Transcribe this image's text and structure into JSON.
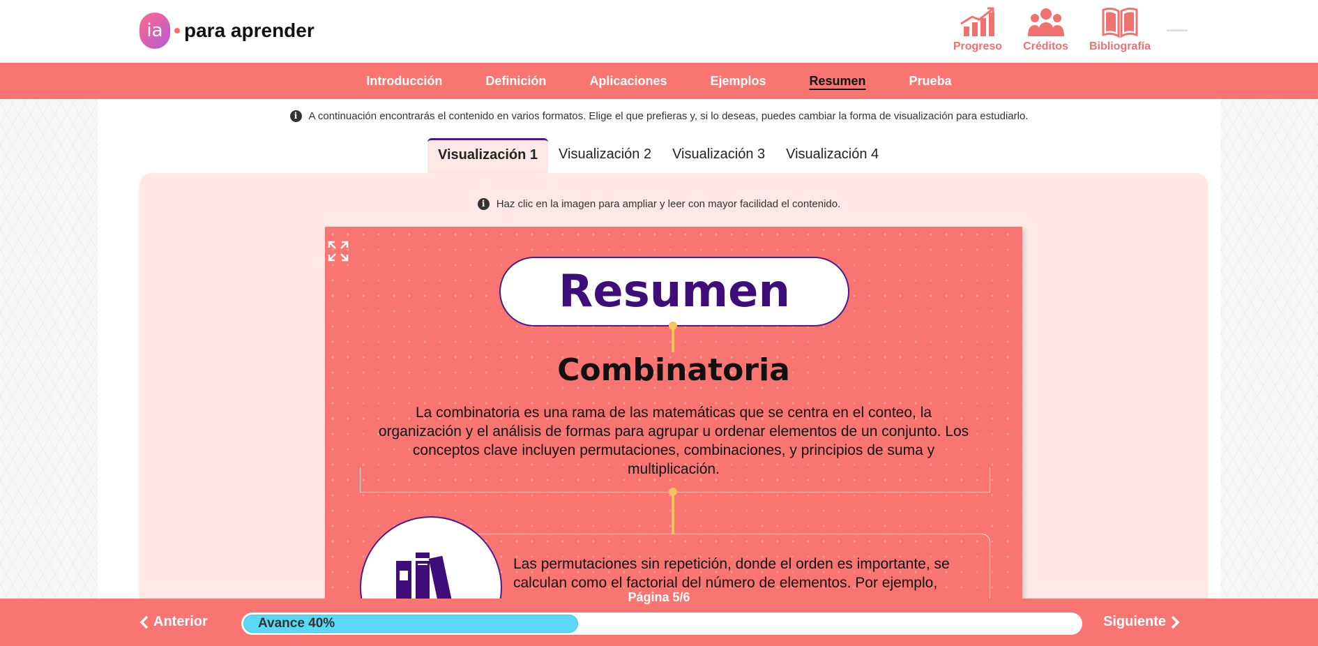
{
  "header": {
    "logo_badge": "ia",
    "logo_text": "para aprender",
    "actions": [
      {
        "label": "Progreso",
        "icon": "chart-up-icon"
      },
      {
        "label": "Créditos",
        "icon": "group-icon"
      },
      {
        "label": "Bibliografía",
        "icon": "book-open-icon"
      }
    ]
  },
  "nav": {
    "items": [
      "Introducción",
      "Definición",
      "Aplicaciones",
      "Ejemplos",
      "Resumen",
      "Prueba"
    ],
    "active": "Resumen"
  },
  "info_text": "A continuación encontrarás el contenido en varios formatos. Elige el que prefieras y, si lo deseas, puedes cambiar la forma de visualización para estudiarlo.",
  "tabs": {
    "items": [
      "Visualización 1",
      "Visualización 2",
      "Visualización 3",
      "Visualización 4"
    ],
    "active": "Visualización 1"
  },
  "panel_info": "Haz clic en la imagen para ampliar y leer con mayor facilidad el contenido.",
  "infographic": {
    "title": "Resumen",
    "subtitle": "Combinatoria",
    "intro": "La combinatoria es una rama de las matemáticas que se centra en el conteo, la organización y el análisis de formas para agrupar u ordenar elementos de un conjunto. Los conceptos clave incluyen permutaciones, combinaciones, y principios de suma y multiplicación.",
    "concept_text": "Las permutaciones sin repetición, donde el orden es importante, se calculan como el factorial del número de elementos. Por ejemplo,"
  },
  "footer": {
    "prev_label": "Anterior",
    "next_label": "Siguiente",
    "page_label": "Página 5/6",
    "progress_label": "Avance 40%",
    "progress_fraction": 0.4
  },
  "colors": {
    "accent": "#f97571",
    "purple": "#3f0d7a",
    "progress": "#5ad8f5",
    "panel": "#fde8e6"
  }
}
